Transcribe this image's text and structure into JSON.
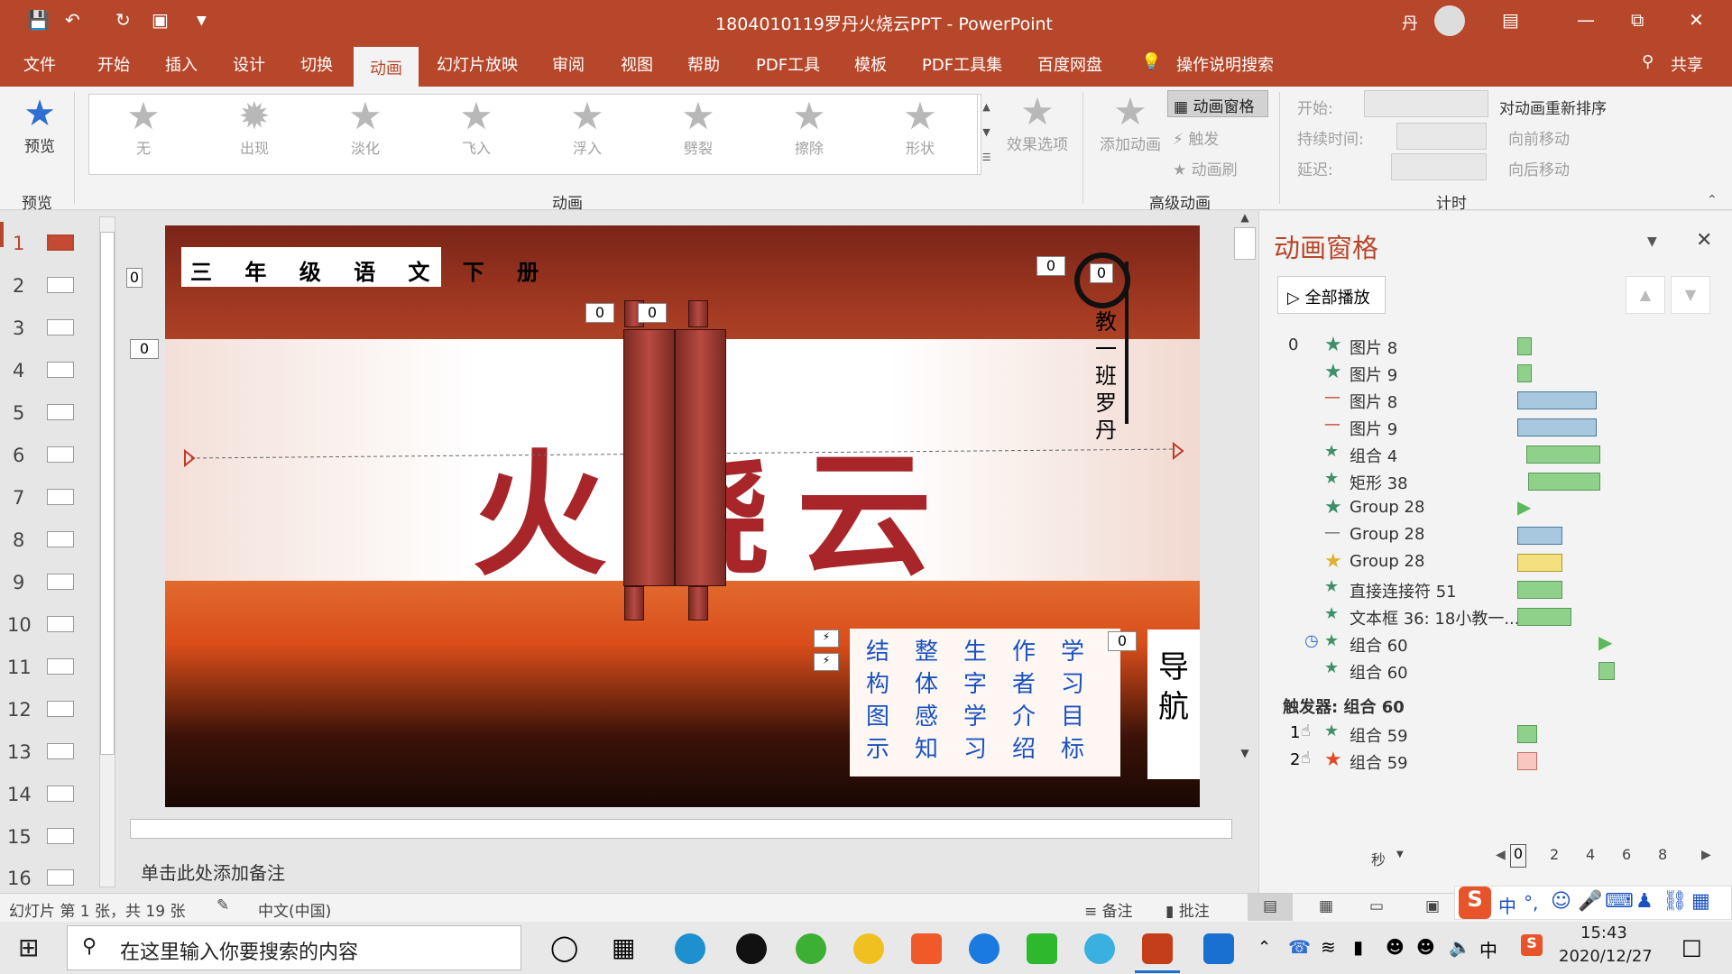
{
  "window": {
    "title": "1804010119罗丹火烧云PPT  -  PowerPoint",
    "user": "丹"
  },
  "tabs": [
    "文件",
    "开始",
    "插入",
    "设计",
    "切换",
    "动画",
    "幻灯片放映",
    "审阅",
    "视图",
    "帮助",
    "PDF工具",
    "模板",
    "PDF工具集",
    "百度网盘",
    "操作说明搜索",
    "共享"
  ],
  "active_tab": "动画",
  "ribbon": {
    "preview_label": "预览",
    "preview_group": "预览",
    "animations": [
      "无",
      "出现",
      "淡化",
      "飞入",
      "浮入",
      "劈裂",
      "擦除",
      "形状"
    ],
    "animation_group": "动画",
    "effect_options": "效果选项",
    "add_animation": "添加动画",
    "animation_pane": "动画窗格",
    "trigger": "触发",
    "painter": "动画刷",
    "advanced_group": "高级动画",
    "start_label": "开始:",
    "duration_label": "持续时间:",
    "delay_label": "延迟:",
    "reorder": "对动画重新排序",
    "move_earlier": "向前移动",
    "move_later": "向后移动",
    "timing_group": "计时"
  },
  "slides": {
    "count": 16,
    "numbers": [
      "1",
      "2",
      "3",
      "4",
      "5",
      "6",
      "7",
      "8",
      "9",
      "10",
      "11",
      "12",
      "13",
      "14",
      "15",
      "16"
    ]
  },
  "slide": {
    "grade": "三 年 级 语 文 下 册",
    "title": "火烧云",
    "teacher": "教一班罗丹",
    "tag": "0",
    "nav_cols": [
      "结构图示",
      "整体感知",
      "生字学习",
      "作者介绍",
      "学习目标"
    ],
    "nav_title": "导航"
  },
  "notes": "单击此处添加备注",
  "pane": {
    "title": "动画窗格",
    "play_all": "全部播放",
    "start_index": "0",
    "items": [
      {
        "name": "图片 8",
        "kind": "entrance",
        "bar": "green"
      },
      {
        "name": "图片 9",
        "kind": "entrance",
        "bar": "green"
      },
      {
        "name": "图片 8",
        "kind": "path",
        "bar": "blue"
      },
      {
        "name": "图片 9",
        "kind": "path",
        "bar": "blue"
      },
      {
        "name": "组合 4",
        "kind": "entrance",
        "bar": "green"
      },
      {
        "name": "矩形 38",
        "kind": "entrance",
        "bar": "green"
      },
      {
        "name": "Group 28",
        "kind": "entrance",
        "bar": "arrow"
      },
      {
        "name": "Group 28",
        "kind": "path",
        "bar": "blue"
      },
      {
        "name": "Group 28",
        "kind": "emphasis",
        "bar": "yellow"
      },
      {
        "name": "直接连接符 51",
        "kind": "entrance",
        "bar": "green"
      },
      {
        "name": "文本框 36: 18小教一...",
        "kind": "entrance",
        "bar": "green"
      },
      {
        "name": "组合 60",
        "kind": "entrance",
        "bar": "arrow"
      },
      {
        "name": "组合 60",
        "kind": "entrance",
        "bar": "green"
      }
    ],
    "trigger_label": "触发器: 组合 60",
    "trigger_items": [
      {
        "num": "1",
        "name": "组合 59",
        "bar": "green"
      },
      {
        "num": "2",
        "name": "组合 59",
        "bar": "red"
      }
    ],
    "seconds": "秒",
    "ticks": [
      "0",
      "2",
      "4",
      "6",
      "8"
    ]
  },
  "status": {
    "slide_info": "幻灯片 第 1 张，共 19 张",
    "language": "中文(中国)",
    "notes": "备注",
    "comments": "批注"
  },
  "taskbar": {
    "search_placeholder": "在这里输入你要搜索的内容",
    "time": "15:43",
    "date": "2020/12/27",
    "ime": "中"
  }
}
